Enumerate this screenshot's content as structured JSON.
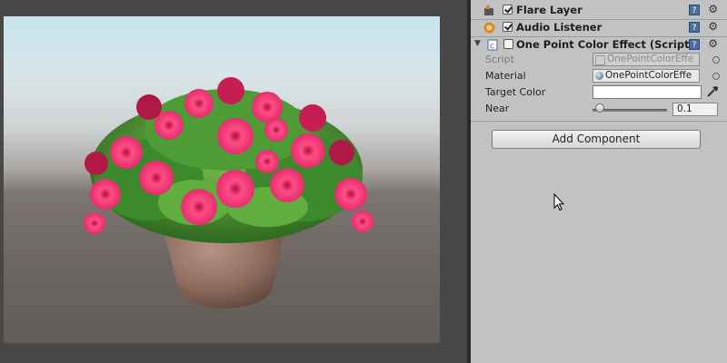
{
  "inspector": {
    "components": [
      {
        "name": "Flare Layer",
        "enabled": true
      },
      {
        "name": "Audio Listener",
        "enabled": true
      },
      {
        "name": "One Point Color Effect (Script)",
        "enabled": false
      }
    ],
    "help_glyph": "?",
    "gear_glyph": "⚙",
    "fold_glyph": "▼",
    "properties": {
      "script": {
        "label": "Script",
        "value": "OnePointColorEffe"
      },
      "material": {
        "label": "Material",
        "value": "OnePointColorEffe"
      },
      "target_color": {
        "label": "Target Color",
        "color": "#ffffff"
      },
      "near": {
        "label": "Near",
        "value": "0.1",
        "fraction": 0.1
      }
    },
    "add_component_label": "Add Component"
  },
  "colors": {
    "inspector_bg": "#c2c2c2",
    "flower_pink": "#e8306b",
    "leaf_green": "#3c8a2c",
    "pot": "#8e6d5f"
  }
}
